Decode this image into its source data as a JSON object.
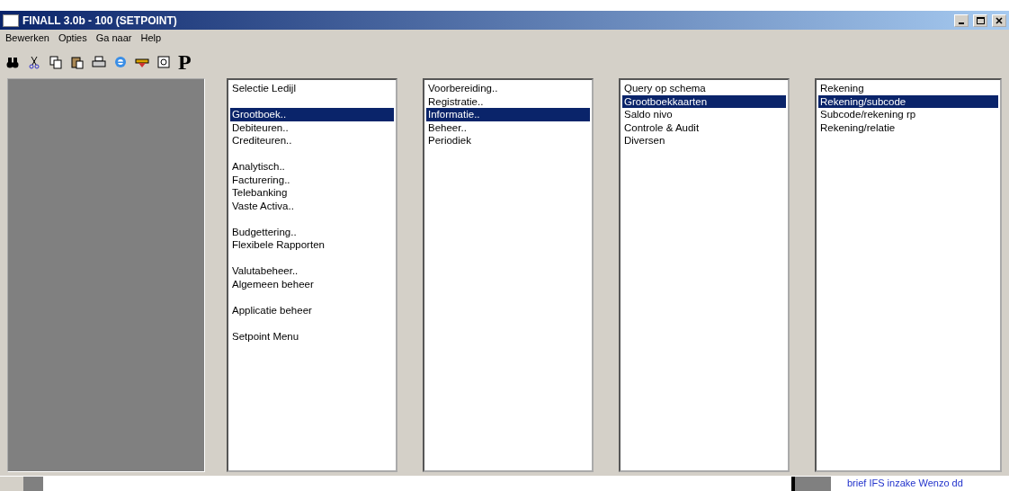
{
  "window": {
    "title": "FINALL 3.0b - 100 (SETPOINT)"
  },
  "menu": [
    "Bewerken",
    "Opties",
    "Ga naar",
    "Help"
  ],
  "toolbar": {
    "logo_letter": "P"
  },
  "lists": [
    {
      "items": [
        {
          "kind": "item",
          "label": "Selectie Ledijl",
          "selected": false
        },
        {
          "kind": "spacer"
        },
        {
          "kind": "item",
          "label": "Grootboek..",
          "selected": true
        },
        {
          "kind": "item",
          "label": "Debiteuren..",
          "selected": false
        },
        {
          "kind": "item",
          "label": "Crediteuren..",
          "selected": false
        },
        {
          "kind": "spacer"
        },
        {
          "kind": "item",
          "label": "Analytisch..",
          "selected": false
        },
        {
          "kind": "item",
          "label": "Facturering..",
          "selected": false
        },
        {
          "kind": "item",
          "label": "Telebanking",
          "selected": false
        },
        {
          "kind": "item",
          "label": "Vaste Activa..",
          "selected": false
        },
        {
          "kind": "spacer"
        },
        {
          "kind": "item",
          "label": "Budgettering..",
          "selected": false
        },
        {
          "kind": "item",
          "label": "Flexibele Rapporten",
          "selected": false
        },
        {
          "kind": "spacer"
        },
        {
          "kind": "item",
          "label": "Valutabeheer..",
          "selected": false
        },
        {
          "kind": "item",
          "label": "Algemeen beheer",
          "selected": false
        },
        {
          "kind": "spacer"
        },
        {
          "kind": "item",
          "label": "Applicatie beheer",
          "selected": false
        },
        {
          "kind": "spacer"
        },
        {
          "kind": "item",
          "label": "Setpoint Menu",
          "selected": false
        }
      ]
    },
    {
      "items": [
        {
          "kind": "item",
          "label": "Voorbereiding..",
          "selected": false
        },
        {
          "kind": "item",
          "label": "Registratie..",
          "selected": false
        },
        {
          "kind": "item",
          "label": "Informatie..",
          "selected": true
        },
        {
          "kind": "item",
          "label": "Beheer..",
          "selected": false
        },
        {
          "kind": "item",
          "label": "Periodiek",
          "selected": false
        }
      ]
    },
    {
      "items": [
        {
          "kind": "item",
          "label": "Query op schema",
          "selected": false
        },
        {
          "kind": "item",
          "label": "Grootboekkaarten",
          "selected": true
        },
        {
          "kind": "item",
          "label": "Saldo nivo",
          "selected": false
        },
        {
          "kind": "item",
          "label": "Controle & Audit",
          "selected": false
        },
        {
          "kind": "item",
          "label": "Diversen",
          "selected": false
        }
      ]
    },
    {
      "items": [
        {
          "kind": "item",
          "label": "Rekening",
          "selected": false
        },
        {
          "kind": "item",
          "label": "Rekening/subcode",
          "selected": true
        },
        {
          "kind": "item",
          "label": "Subcode/rekening rp",
          "selected": false
        },
        {
          "kind": "item",
          "label": "Rekening/relatie",
          "selected": false
        }
      ]
    }
  ],
  "background_window": {
    "link": "brief IFS inzake Wenzo dd"
  }
}
